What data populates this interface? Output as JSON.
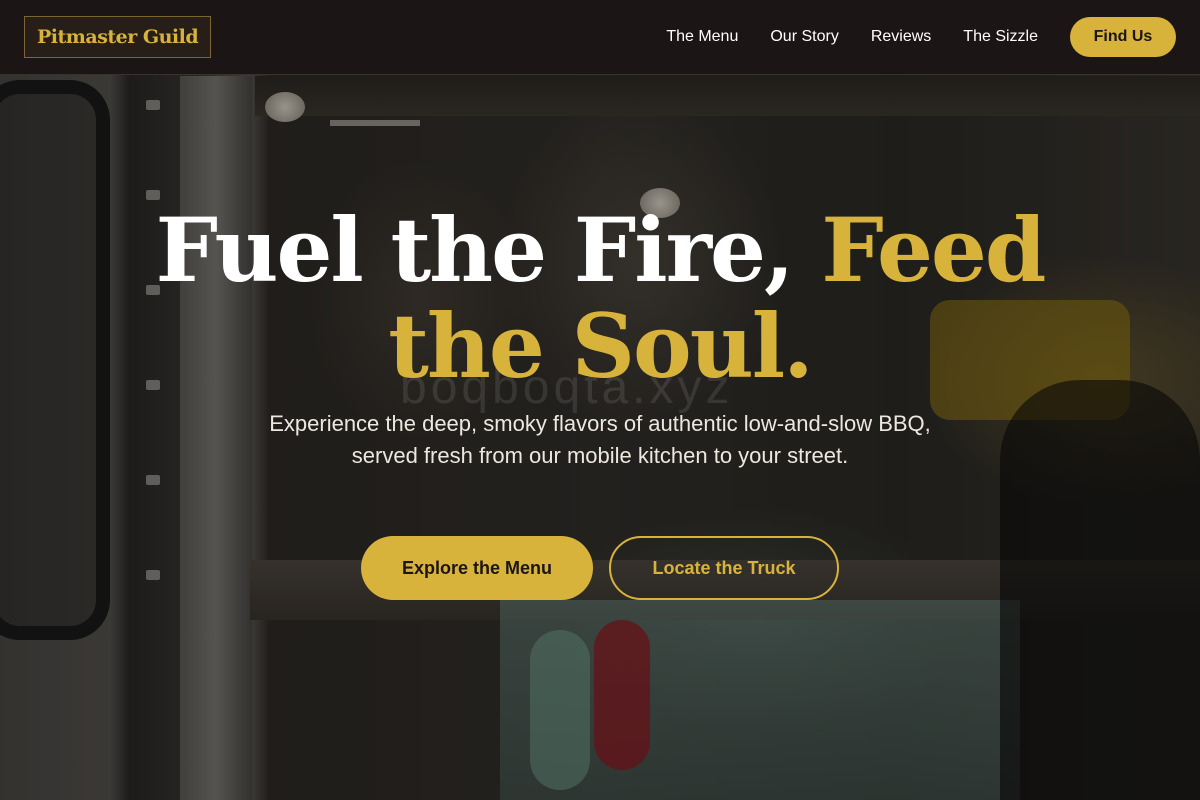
{
  "brand": {
    "logo_text": "Pitmaster Guild"
  },
  "nav": {
    "links": [
      "The Menu",
      "Our Story",
      "Reviews",
      "The Sizzle"
    ],
    "cta_label": "Find Us"
  },
  "hero": {
    "headline_white": "Fuel the Fire, ",
    "headline_accent": "Feed the Soul.",
    "subtitle": "Experience the deep, smoky flavors of authentic low-and-slow BBQ, served fresh from our mobile kitchen to your street.",
    "primary_button": "Explore the Menu",
    "secondary_button": "Locate the Truck",
    "watermark": "boqboqta.xyz"
  },
  "colors": {
    "accent": "#d8b33c",
    "nav_background": "#1c1515",
    "headline": "#ffffff"
  }
}
